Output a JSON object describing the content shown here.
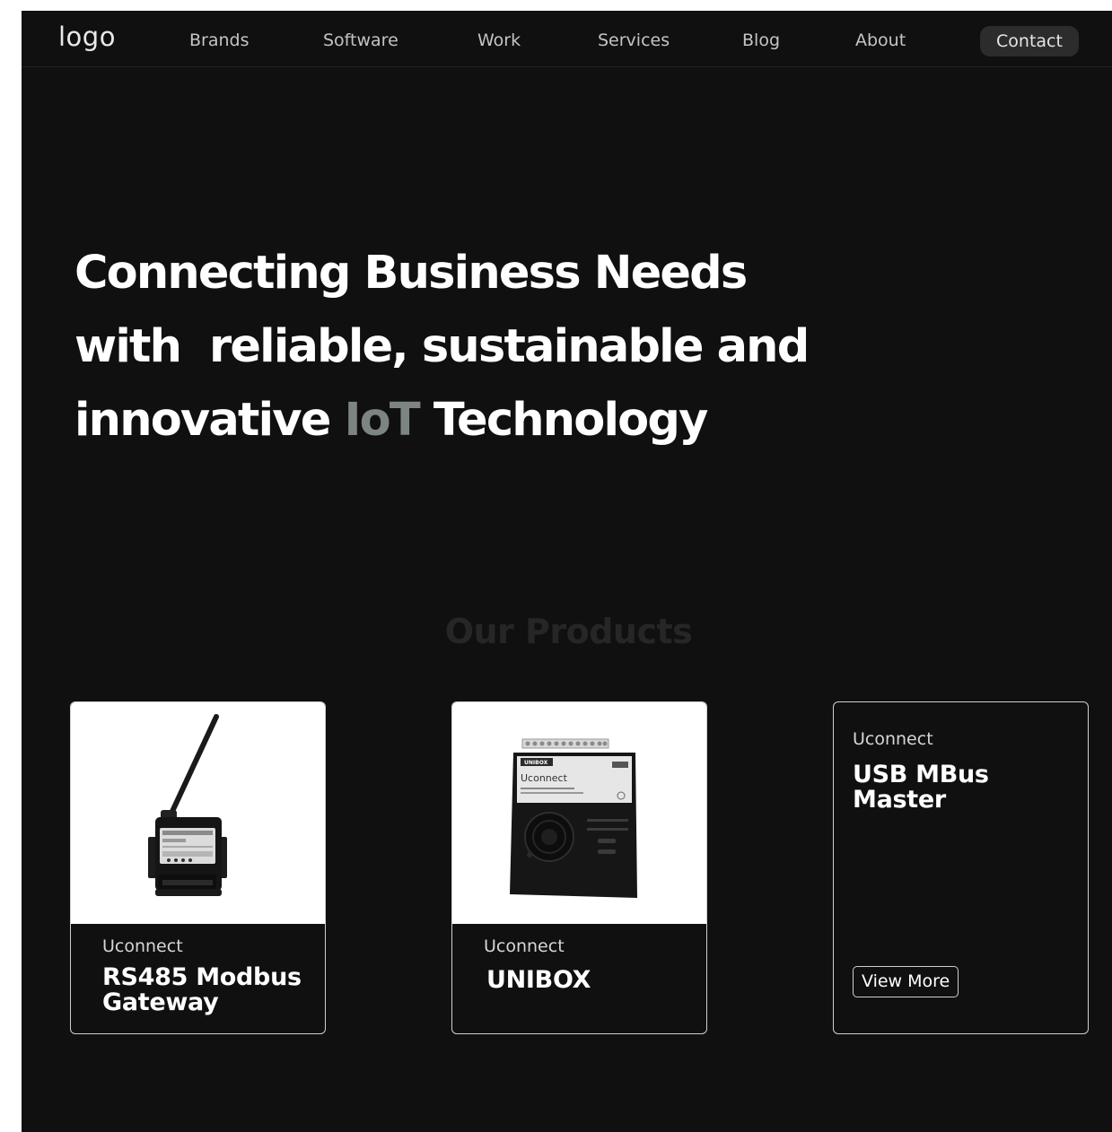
{
  "nav": {
    "logo": "logo",
    "links": [
      "Brands",
      "Software",
      "Work",
      "Services",
      "Blog",
      "About"
    ],
    "contact": "Contact"
  },
  "hero": {
    "line1": "Connecting Business Needs",
    "line2": "with  reliable, sustainable and",
    "line3_start": "innovative ",
    "line3_accent": "IoT",
    "line3_end": " Technology",
    "accent_color": "#7d8583"
  },
  "products": {
    "title": "Our Products",
    "cards": [
      {
        "brand": "Uconnect",
        "name": "RS485 Modbus Gateway",
        "image": "rs485-gateway-with-antenna"
      },
      {
        "brand": "Uconnect",
        "name": "UNIBOX",
        "image": "unibox-device",
        "device_label": "UNIBOX",
        "device_logo": "Uconnect"
      },
      {
        "brand": "Uconnect",
        "name": "USB MBus Master",
        "button": "View More"
      }
    ]
  },
  "colors": {
    "background": "#101010",
    "page_margin": "#ffffff",
    "card_border": "#d0d0d0",
    "contact_pill": "#2c2c2c"
  }
}
